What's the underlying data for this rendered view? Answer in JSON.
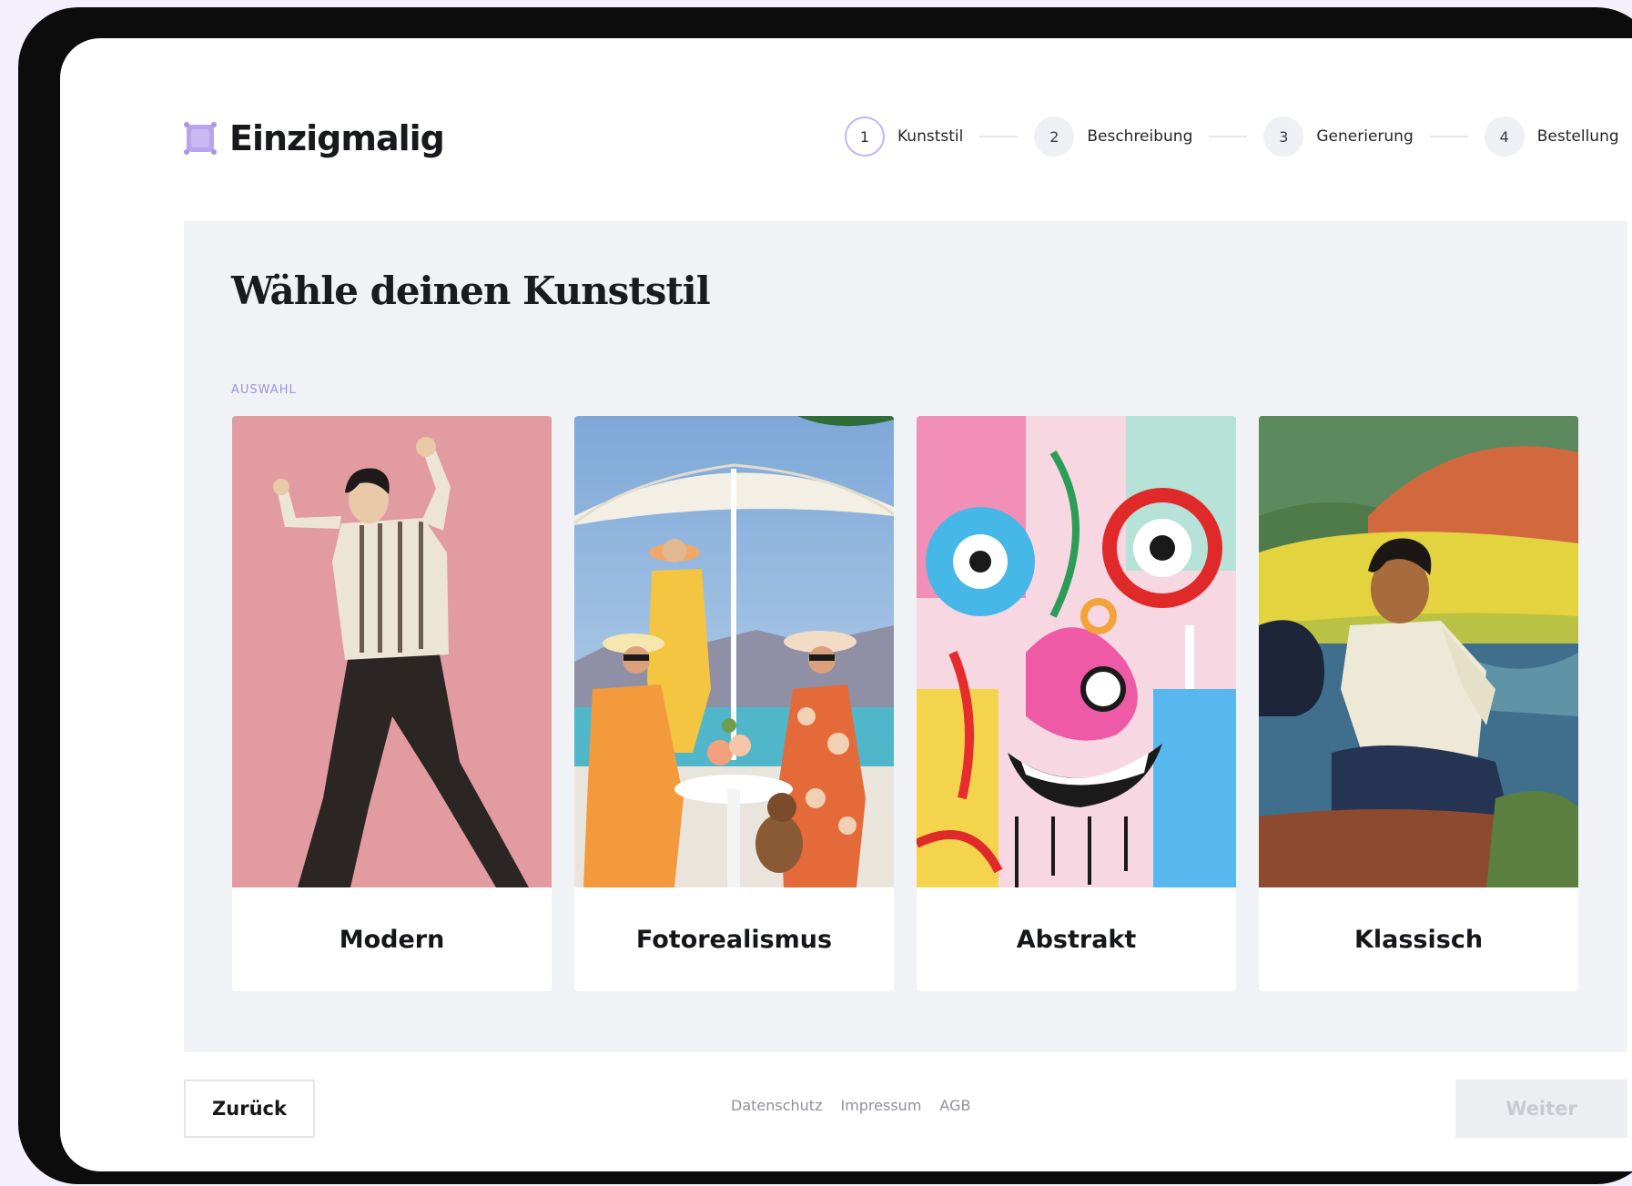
{
  "brand": {
    "name": "Einzigmalig",
    "accent": "#b7a4ec"
  },
  "stepper": {
    "steps": [
      {
        "number": "1",
        "label": "Kunststil"
      },
      {
        "number": "2",
        "label": "Beschreibung"
      },
      {
        "number": "3",
        "label": "Generierung"
      },
      {
        "number": "4",
        "label": "Bestellung"
      }
    ]
  },
  "main": {
    "title": "Wähle deinen Kunststil",
    "section_label": "AUSWAHL",
    "cards": [
      {
        "label": "Modern"
      },
      {
        "label": "Fotorealismus"
      },
      {
        "label": "Abstrakt"
      },
      {
        "label": "Klassisch"
      }
    ]
  },
  "footer": {
    "back_label": "Zurück",
    "links": [
      "Datenschutz",
      "Impressum",
      "AGB"
    ],
    "next_label": "Weiter"
  }
}
